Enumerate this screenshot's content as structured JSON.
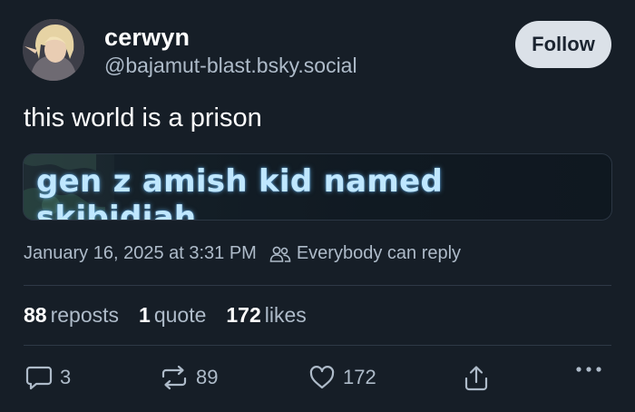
{
  "author": {
    "display_name": "cerwyn",
    "handle": "@bajamut-blast.bsky.social"
  },
  "follow_button": {
    "label": "Follow"
  },
  "post": {
    "text": "this world is a prison",
    "image_caption": "gen z amish kid named skibidiah",
    "timestamp": "January 16, 2025 at 3:31 PM",
    "reply_setting": "Everybody can reply"
  },
  "stats": {
    "reposts": {
      "count": "88",
      "label": "reposts"
    },
    "quotes": {
      "count": "1",
      "label": "quote"
    },
    "likes": {
      "count": "172",
      "label": "likes"
    }
  },
  "actions": {
    "reply_count": "3",
    "repost_count": "89",
    "like_count": "172"
  },
  "icons": {
    "reply": "comment-icon",
    "repost": "repost-icon",
    "like": "heart-icon",
    "share": "share-icon",
    "more": "more-icon",
    "reply_setting": "people-icon"
  },
  "colors": {
    "background": "#161e27",
    "muted_text": "#aebbc9",
    "follow_button_bg": "#dbe1e8",
    "divider": "#2e3946"
  }
}
